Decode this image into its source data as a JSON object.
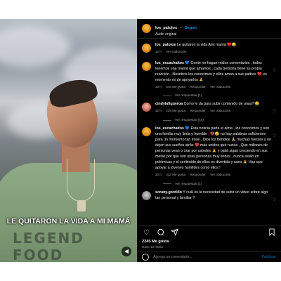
{
  "header": {
    "username": "los_patojos",
    "separator": "•",
    "follow_label": "Seguir",
    "subtitle": "Audio original"
  },
  "media": {
    "overlay_caption": "LE QUITARON LA VIDA A MI MAMÁ",
    "shirt_print": "LEGEND FOOD",
    "mute_icon": "speaker-muted-icon"
  },
  "comments": [
    {
      "username": "los_patojos",
      "text": "Le quitaron la vida Ami mamá 💔😢",
      "time": "12 h",
      "likes": "",
      "reply_label": "",
      "translate_label": "Ver traducción",
      "replies_label": ""
    },
    {
      "username": "los_escachaitos",
      "text": "💙 Gente no hagan malos comentarios , todos tenemos una mamá que amamos , cada persona tiene su propia reacción , Nosotros los conocimos y ellos aman a sus padres 💔 es momento es de apoyarlos 🙏",
      "time": "10 h",
      "likes": "646 Me gusta",
      "reply_label": "Responder",
      "translate_label": "Ver traducción",
      "replies_label": "Ver respuestas (1)"
    },
    {
      "username": "cindylafigueroa",
      "text": "Como le da para subir contenido de unas? 😢",
      "time": "12 h",
      "likes": "239 Me gusta",
      "reply_label": "Responder",
      "translate_label": "Ver traducción",
      "replies_label": "Ver respuestas (44)"
    },
    {
      "username": "los_escachaitos",
      "text": "💙 Esta noticia parte el alma , los conocimos y son una familia muy linda y humilde , 💔😢 no hay palabras suficientes para un momento tan triste , Dios los bendice 🙏 muchas fuerzas y no dejen sus sueños atrás 💔 más unidos que nunca , Que millones de personas vean o orar por ustedes 🙏 y ojalá sigan creciendo en sus metas por que son unas personas muy lindas , nunca están en polémicas y el contenido de ellos es divertido y sano 🙏 Hay que apoyar a jóvenes humildes como ellos !",
      "time": "10 h",
      "likes": "322 Me gusta",
      "reply_label": "Responder",
      "translate_label": "Ver traducción",
      "replies_label": "Ver respuestas (1)"
    },
    {
      "username": "sorany.gordillo",
      "text": "Y cuál es la necesidad de subir un video sobre algo tan personal y familiar ?",
      "time": "",
      "likes": "",
      "reply_label": "",
      "translate_label": "",
      "replies_label": ""
    }
  ],
  "actions": {
    "like_icon": "heart-icon",
    "comment_icon": "comment-icon",
    "share_icon": "share-icon",
    "save_icon": "bookmark-icon"
  },
  "stats": {
    "likes": "2245 Me gusta",
    "posted_ago": "Hace 12 horas"
  },
  "composer": {
    "placeholder": "Agrega un comentario...",
    "publish_label": "Publicar"
  },
  "colors": {
    "accent": "#0095f6",
    "panel_bg": "#000000",
    "muted_text": "#a8a8a8"
  }
}
